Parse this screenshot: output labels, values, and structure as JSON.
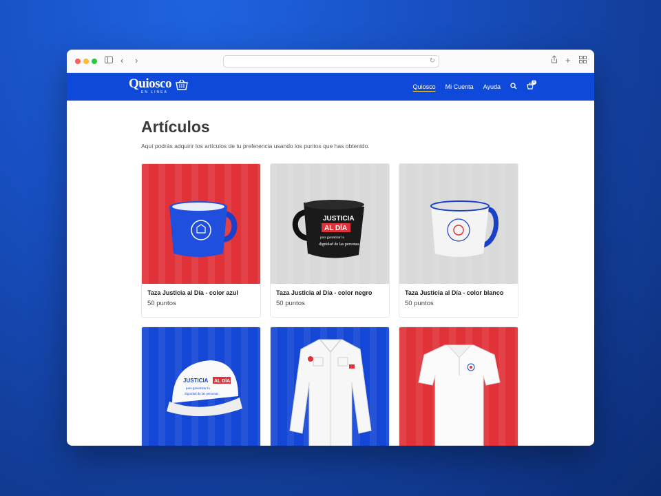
{
  "browser": {
    "url": ""
  },
  "site": {
    "logo_text": "Quiosco",
    "logo_subtext": "EN LINEA",
    "nav": [
      {
        "label": "Quiosco",
        "active": true
      },
      {
        "label": "Mi Cuenta",
        "active": false
      },
      {
        "label": "Ayuda",
        "active": false
      }
    ],
    "search_icon": "search-icon",
    "cart_icon": "cart-icon",
    "cart_count": "0"
  },
  "page": {
    "title": "Artículos",
    "subtitle": "Aquí podrás adquirir los artículos de tu preferencia usando los puntos que has obtenido."
  },
  "products": [
    {
      "name": "Taza Justicia al Día - color azul",
      "points": "50 puntos",
      "bg": "#e1323a",
      "item": "blue-mug"
    },
    {
      "name": "Taza Justicia al Día - color negro",
      "points": "50 puntos",
      "bg": "#d9d9d9",
      "item": "black-mug"
    },
    {
      "name": "Taza Justicia al Día - color blanco",
      "points": "50 puntos",
      "bg": "#d9d9d9",
      "item": "white-mug"
    },
    {
      "name": "",
      "points": "",
      "bg": "#1447d6",
      "item": "white-cap"
    },
    {
      "name": "",
      "points": "",
      "bg": "#1447d6",
      "item": "white-shirt"
    },
    {
      "name": "",
      "points": "",
      "bg": "#e1323a",
      "item": "white-polo"
    }
  ],
  "mug_print": {
    "line1": "JUSTICIA",
    "line2": "AL DÍA",
    "line3": "para garantizar la",
    "line4": "dignidad de las personas"
  },
  "colors": {
    "brand_blue": "#0e49d9",
    "accent_red": "#e1323a",
    "accent_yellow": "#ffd23c"
  }
}
